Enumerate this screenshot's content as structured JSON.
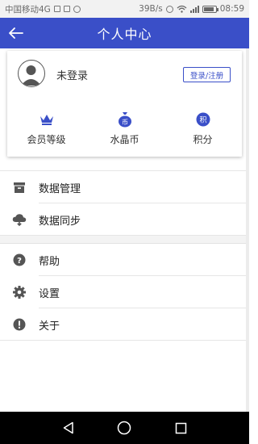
{
  "status_bar": {
    "carrier": "中国移动4G",
    "speed": "39B/s",
    "network": "4G",
    "time": "08:59",
    "battery_level": 0.9
  },
  "app_bar": {
    "title": "个人中心",
    "back_icon": "arrow-left-icon",
    "color": "#3a4fc8"
  },
  "profile": {
    "avatar_icon": "user-avatar-icon",
    "login_status": "未登录",
    "login_button": "登录/注册"
  },
  "stats": [
    {
      "label": "会员等级",
      "icon": "crown-icon",
      "glyph": ""
    },
    {
      "label": "水晶币",
      "icon": "coin-bag-icon",
      "glyph": "币"
    },
    {
      "label": "积分",
      "icon": "points-icon",
      "glyph": "积"
    }
  ],
  "menu_group_1": [
    {
      "label": "数据管理",
      "icon": "archive-icon"
    },
    {
      "label": "数据同步",
      "icon": "cloud-sync-icon"
    }
  ],
  "menu_group_2": [
    {
      "label": "帮助",
      "icon": "help-icon"
    },
    {
      "label": "设置",
      "icon": "gear-icon"
    },
    {
      "label": "关于",
      "icon": "info-icon"
    }
  ],
  "nav_bar": {
    "back": "nav-back-icon",
    "home": "nav-home-icon",
    "recents": "nav-recents-icon"
  }
}
